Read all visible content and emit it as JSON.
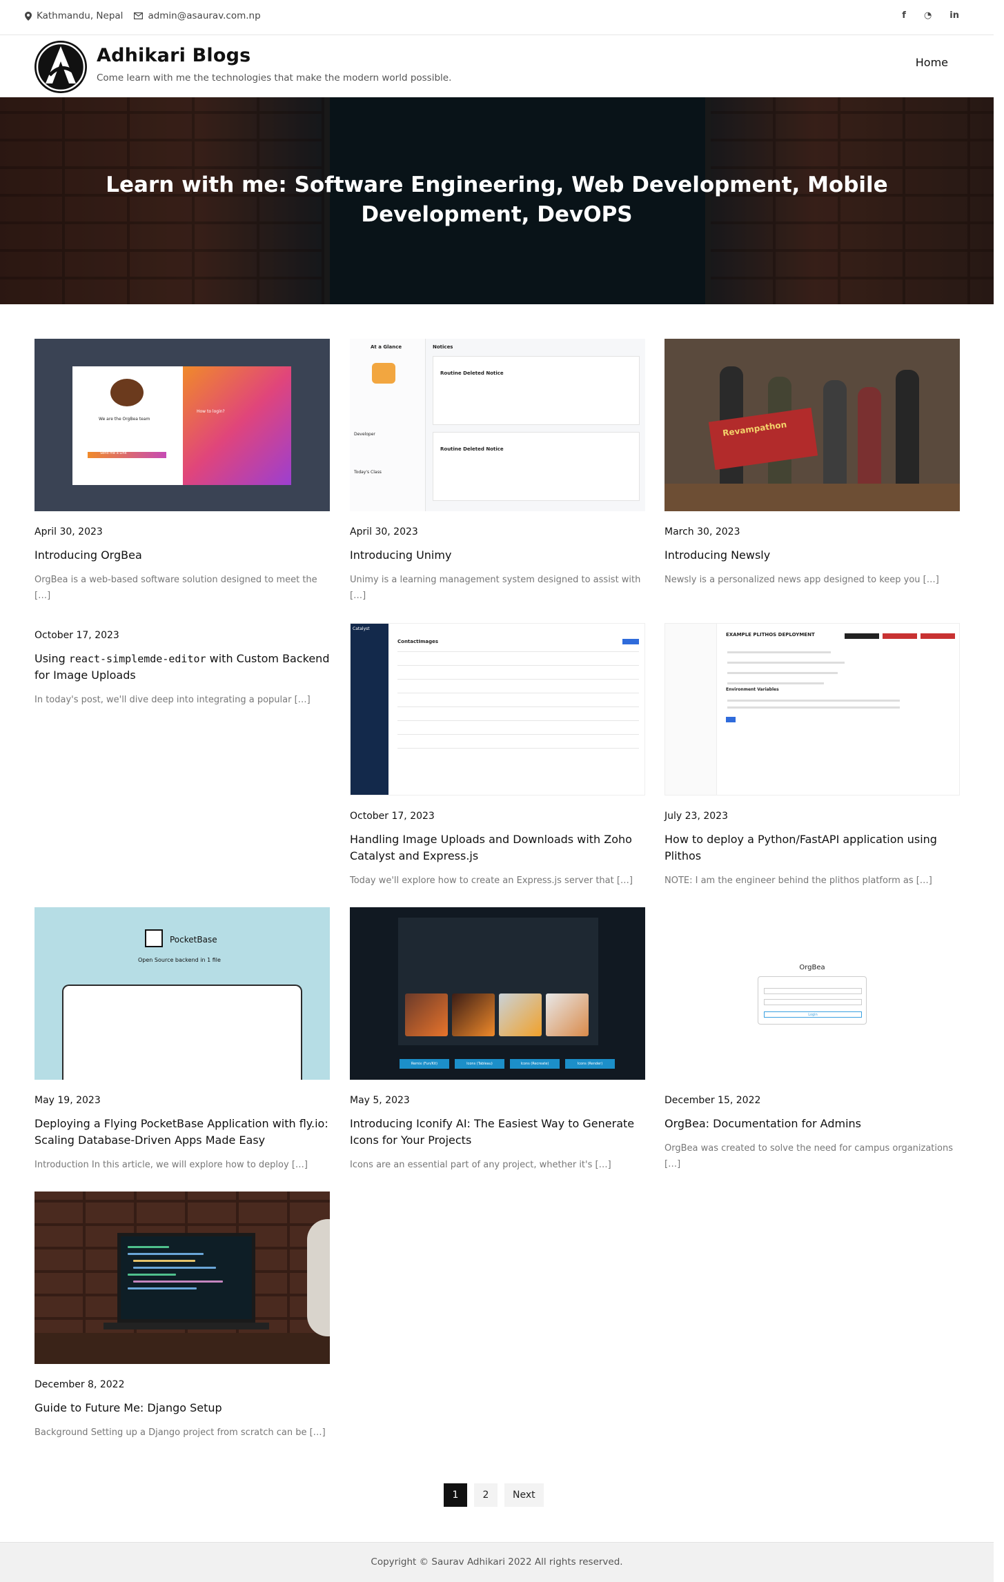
{
  "topbar": {
    "location": "Kathmandu, Nepal",
    "email": "admin@asaurav.com.np",
    "social": [
      {
        "icon": "facebook-icon",
        "glyph": "f"
      },
      {
        "icon": "github-icon",
        "glyph": "◔"
      },
      {
        "icon": "linkedin-icon",
        "glyph": "in"
      }
    ]
  },
  "header": {
    "site_title": "Adhikari Blogs",
    "tagline": "Come learn with me the technologies that make the modern world possible.",
    "nav_home": "Home"
  },
  "hero": {
    "title": "Learn with me: Software Engineering, Web Development, Mobile Development, DevOPS"
  },
  "posts": [
    {
      "date": "April 30, 2023",
      "title": "Introducing OrgBea",
      "excerpt": "OrgBea is a web-based software solution designed to meet the […]",
      "thumb_text": [
        "We are the OrgBea team",
        "How to login?",
        "Send me a Link"
      ]
    },
    {
      "date": "April 30, 2023",
      "title": "Introducing Unimy",
      "excerpt": "Unimy is a learning management system designed to assist with […]",
      "thumb_text": [
        "At a Glance",
        "Notices",
        "Routine Deleted Notice",
        "Routine Deleted Notice",
        "Developer",
        "Today's Class"
      ]
    },
    {
      "date": "March 30, 2023",
      "title": "Introducing Newsly",
      "excerpt": "Newsly is a personalized news app designed to keep you […]",
      "thumb_text": [
        "Revampathon"
      ]
    },
    {
      "date": "October 17, 2023",
      "title_prefix": "Using ",
      "title_code": "react-simplemde-editor",
      "title_suffix": " with Custom Backend for Image Uploads",
      "excerpt": "In today's post, we'll dive deep into integrating a popular […]"
    },
    {
      "date": "October 17, 2023",
      "title": "Handling Image Uploads and Downloads with Zoho Catalyst and Express.js",
      "excerpt": "Today we'll explore how to create an Express.js server that […]",
      "thumb_text": [
        "Catalyst",
        "ContactImages"
      ]
    },
    {
      "date": "July 23, 2023",
      "title": "How to deploy a Python/FastAPI application using Plithos",
      "excerpt": "NOTE: I am the engineer behind the plithos platform as […]",
      "thumb_text": [
        "EXAMPLE PLITHOS DEPLOYMENT",
        "Environment Variables"
      ]
    },
    {
      "date": "May 19, 2023",
      "title": "Deploying a Flying PocketBase Application with fly.io: Scaling Database-Driven Apps Made Easy",
      "excerpt": "Introduction In this article, we will explore how to deploy […]",
      "thumb_text": [
        "PocketBase",
        "Open Source backend in 1 file"
      ]
    },
    {
      "date": "May 5, 2023",
      "title": "Introducing Iconify AI: The Easiest Way to Generate Icons for Your Projects",
      "excerpt": "Icons are an essential part of any project, whether it's […]",
      "thumb_text": [
        "Remix (Fun/Kit)",
        "Icons (Tableau)",
        "Icons (Recreate)",
        "Icons (Render)"
      ]
    },
    {
      "date": "December 15, 2022",
      "title": "OrgBea: Documentation for Admins",
      "excerpt": "OrgBea was created to solve the need for campus organizations […]",
      "thumb_text": [
        "OrgBea",
        "Login"
      ]
    },
    {
      "date": "December 8, 2022",
      "title": "Guide to Future Me: Django Setup",
      "excerpt": "Background Setting up a Django project from scratch can be […]"
    }
  ],
  "pagination": {
    "pages": [
      "1",
      "2"
    ],
    "active": "1",
    "next": "Next"
  },
  "footer": {
    "copyright": "Copyright © Saurav Adhikari 2022 All rights reserved."
  },
  "colors": {
    "accent": "#111111",
    "footer_bg": "#f1f1f1",
    "excerpt": "#777777"
  }
}
